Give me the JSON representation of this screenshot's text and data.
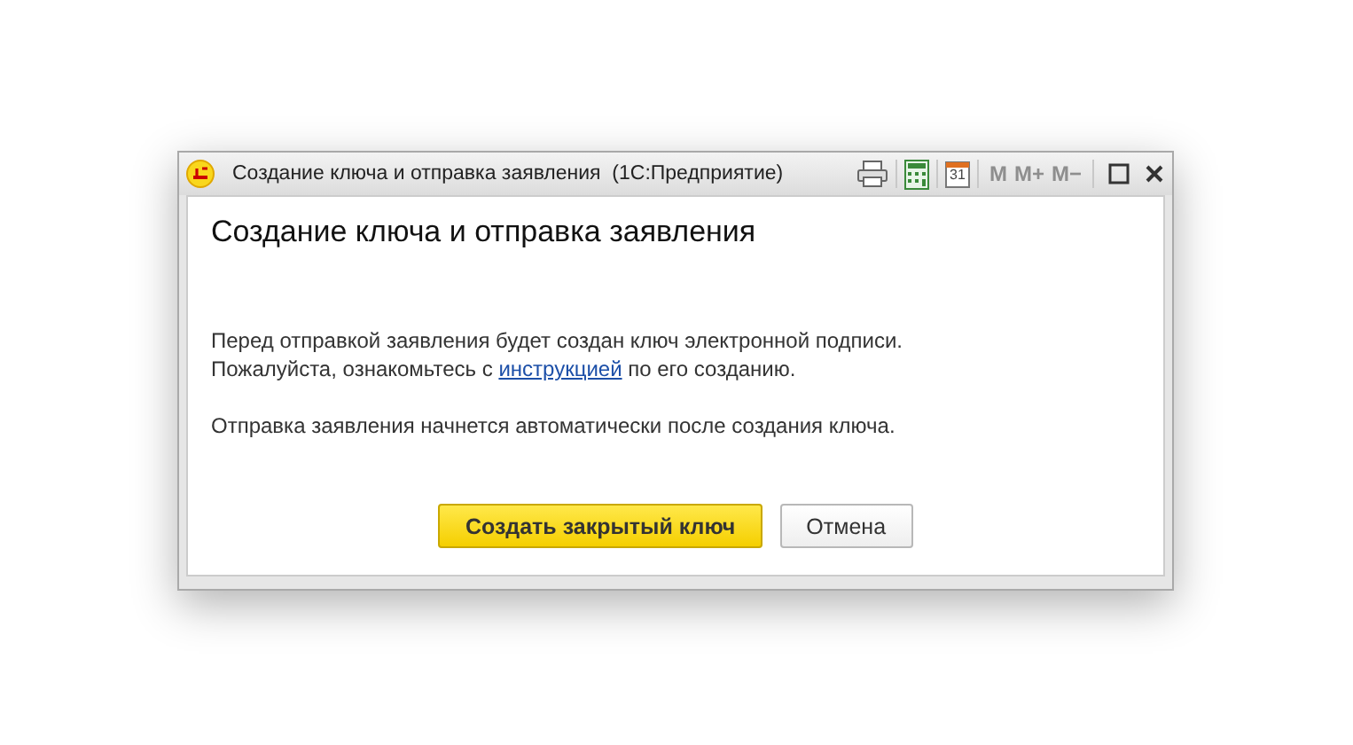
{
  "window": {
    "title": "Создание ключа и отправка заявления  (1С:Предприятие)",
    "calendar_day": "31",
    "memory_buttons": [
      {
        "label": "M",
        "disabled": true
      },
      {
        "label": "M+",
        "disabled": true
      },
      {
        "label": "M−",
        "disabled": true
      }
    ]
  },
  "heading": "Создание ключа и отправка заявления",
  "message": {
    "line1": "Перед отправкой заявления будет создан ключ электронной подписи.",
    "line2_before": "Пожалуйста, ознакомьтесь с ",
    "link": "инструкцией",
    "line2_after": " по его созданию."
  },
  "note": "Отправка заявления начнется автоматически после создания ключа.",
  "buttons": [
    {
      "label": "Создать закрытый ключ",
      "kind": "primary"
    },
    {
      "label": "Отмена",
      "kind": "default"
    }
  ]
}
